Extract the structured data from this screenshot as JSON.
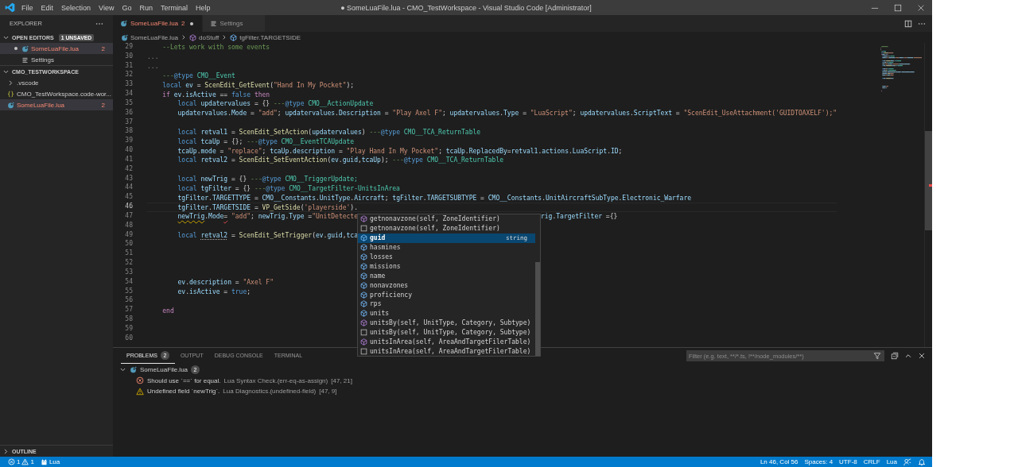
{
  "window": {
    "title": "● SomeLuaFile.lua - CMO_TestWorkspace - Visual Studio Code [Administrator]"
  },
  "menu": [
    "File",
    "Edit",
    "Selection",
    "View",
    "Go",
    "Run",
    "Terminal",
    "Help"
  ],
  "sidebar": {
    "title": "EXPLORER",
    "open_editors": {
      "label": "OPEN EDITORS",
      "badge": "1 UNSAVED",
      "expanded": true,
      "items": [
        {
          "label": "SomeLuaFile.lua",
          "kind": "lua",
          "dirty": true,
          "errors": "2",
          "selected": true
        },
        {
          "label": "Settings",
          "kind": "settings",
          "dirty": false,
          "selected": false
        }
      ]
    },
    "workspace": {
      "label": "CMO_TESTWORKSPACE",
      "expanded": true,
      "items": [
        {
          "label": ".vscode",
          "kind": "folder",
          "expanded": false,
          "selected": false
        },
        {
          "label": "CMO_TestWorkspace.code-wor...",
          "kind": "json",
          "selected": false
        },
        {
          "label": "SomeLuaFile.lua",
          "kind": "lua",
          "errors": "2",
          "selected": true
        }
      ]
    },
    "outline": {
      "label": "OUTLINE",
      "expanded": false
    }
  },
  "tabs": [
    {
      "label": "SomeLuaFile.lua",
      "kind": "lua",
      "errors": "2",
      "dirty": true,
      "selected": true
    },
    {
      "label": "Settings",
      "kind": "settings",
      "dirty": false,
      "selected": false
    }
  ],
  "breadcrumbs": [
    {
      "label": "SomeLuaFile.lua",
      "kind": "lua"
    },
    {
      "label": "doStuff",
      "kind": "method"
    },
    {
      "label": "tgFilter.TARGETSIDE",
      "kind": "field"
    }
  ],
  "editor": {
    "lines": [
      {
        "number": "29",
        "current": false,
        "tokens": [
          {
            "kind": "m",
            "text": "\t--Lets work with some events"
          }
        ]
      },
      {
        "number": "30",
        "current": false,
        "tokens": [
          {
            "kind": "d",
            "text": "..."
          }
        ]
      },
      {
        "number": "31",
        "current": false,
        "tokens": [
          {
            "kind": "d",
            "text": "..."
          }
        ]
      },
      {
        "number": "32",
        "current": false,
        "tokens": [
          {
            "kind": "m",
            "text": "\t---"
          },
          {
            "kind": "a",
            "text": "@type"
          },
          {
            "kind": "t",
            "text": " CMO__Event"
          }
        ]
      },
      {
        "number": "33",
        "current": false,
        "tokens": [
          {
            "kind": "k",
            "text": "\tlocal"
          },
          {
            "kind": "v",
            "text": " ev"
          },
          {
            "kind": "p",
            "text": " = "
          },
          {
            "kind": "f",
            "text": "ScenEdit_GetEvent"
          },
          {
            "kind": "p",
            "text": "("
          },
          {
            "kind": "s",
            "text": "\"Hand In My Pocket\""
          },
          {
            "kind": "p",
            "text": ");"
          }
        ]
      },
      {
        "number": "34",
        "current": false,
        "tokens": [
          {
            "kind": "c",
            "text": "\tif"
          },
          {
            "kind": "v",
            "text": " ev"
          },
          {
            "kind": "p",
            "text": "."
          },
          {
            "kind": "v",
            "text": "isActive"
          },
          {
            "kind": "p",
            "text": " == "
          },
          {
            "kind": "k",
            "text": "false"
          },
          {
            "kind": "c",
            "text": " then"
          }
        ]
      },
      {
        "number": "35",
        "current": false,
        "tokens": [
          {
            "kind": "k",
            "text": "\t\tlocal"
          },
          {
            "kind": "v",
            "text": " updatervalues"
          },
          {
            "kind": "p",
            "text": " = {} "
          },
          {
            "kind": "m",
            "text": "---"
          },
          {
            "kind": "a",
            "text": "@type"
          },
          {
            "kind": "t",
            "text": " CMO__ActionUpdate"
          }
        ]
      },
      {
        "number": "36",
        "current": false,
        "tokens": [
          {
            "kind": "v",
            "text": "\t\tupdatervalues"
          },
          {
            "kind": "p",
            "text": "."
          },
          {
            "kind": "v",
            "text": "Mode"
          },
          {
            "kind": "p",
            "text": " = "
          },
          {
            "kind": "s",
            "text": "\"add\""
          },
          {
            "kind": "p",
            "text": "; "
          },
          {
            "kind": "v",
            "text": "updatervalues"
          },
          {
            "kind": "p",
            "text": "."
          },
          {
            "kind": "v",
            "text": "Description"
          },
          {
            "kind": "p",
            "text": " = "
          },
          {
            "kind": "s",
            "text": "\"Play Axel F\""
          },
          {
            "kind": "p",
            "text": "; "
          },
          {
            "kind": "v",
            "text": "updatervalues"
          },
          {
            "kind": "p",
            "text": "."
          },
          {
            "kind": "v",
            "text": "Type"
          },
          {
            "kind": "p",
            "text": " = "
          },
          {
            "kind": "s",
            "text": "\"LuaScript\""
          },
          {
            "kind": "p",
            "text": "; "
          },
          {
            "kind": "v",
            "text": "updatervalues"
          },
          {
            "kind": "p",
            "text": "."
          },
          {
            "kind": "v",
            "text": "ScriptText"
          },
          {
            "kind": "p",
            "text": " = "
          },
          {
            "kind": "s",
            "text": "\"ScenEdit_UseAttachment('GUIDTOAXELF');\""
          }
        ]
      },
      {
        "number": "37",
        "current": false
      },
      {
        "number": "38",
        "current": false,
        "tokens": [
          {
            "kind": "k",
            "text": "\t\tlocal"
          },
          {
            "kind": "v",
            "text": " retval1"
          },
          {
            "kind": "p",
            "text": " = "
          },
          {
            "kind": "f",
            "text": "ScenEdit_SetAction"
          },
          {
            "kind": "p",
            "text": "("
          },
          {
            "kind": "v",
            "text": "updatervalues"
          },
          {
            "kind": "p",
            "text": ") "
          },
          {
            "kind": "m",
            "text": "---"
          },
          {
            "kind": "a",
            "text": "@type"
          },
          {
            "kind": "t",
            "text": " CMO__TCA_ReturnTable"
          }
        ]
      },
      {
        "number": "39",
        "current": false,
        "tokens": [
          {
            "kind": "k",
            "text": "\t\tlocal"
          },
          {
            "kind": "v",
            "text": " tcaUp"
          },
          {
            "kind": "p",
            "text": " = {}; "
          },
          {
            "kind": "m",
            "text": "---"
          },
          {
            "kind": "a",
            "text": "@type"
          },
          {
            "kind": "t",
            "text": " CMO__EventTCAUpdate"
          }
        ]
      },
      {
        "number": "40",
        "current": false,
        "tokens": [
          {
            "kind": "v",
            "text": "\t\ttcaUp"
          },
          {
            "kind": "p",
            "text": "."
          },
          {
            "kind": "v",
            "text": "mode"
          },
          {
            "kind": "p",
            "text": " = "
          },
          {
            "kind": "s",
            "text": "\"replace\""
          },
          {
            "kind": "p",
            "text": "; "
          },
          {
            "kind": "v",
            "text": "tcaUp"
          },
          {
            "kind": "p",
            "text": "."
          },
          {
            "kind": "v",
            "text": "description"
          },
          {
            "kind": "p",
            "text": " = "
          },
          {
            "kind": "s",
            "text": "\"Play Hand In My Pocket\""
          },
          {
            "kind": "p",
            "text": "; "
          },
          {
            "kind": "v",
            "text": "tcaUp"
          },
          {
            "kind": "p",
            "text": "."
          },
          {
            "kind": "v",
            "text": "ReplacedBy"
          },
          {
            "kind": "p",
            "text": "="
          },
          {
            "kind": "v",
            "text": "retval1"
          },
          {
            "kind": "p",
            "text": "."
          },
          {
            "kind": "v",
            "text": "actions"
          },
          {
            "kind": "p",
            "text": "."
          },
          {
            "kind": "v",
            "text": "LuaScript"
          },
          {
            "kind": "p",
            "text": "."
          },
          {
            "kind": "v",
            "text": "ID"
          },
          {
            "kind": "p",
            "text": ";"
          }
        ]
      },
      {
        "number": "41",
        "current": false,
        "tokens": [
          {
            "kind": "k",
            "text": "\t\tlocal"
          },
          {
            "kind": "v",
            "text": " retval2"
          },
          {
            "kind": "p",
            "text": " = "
          },
          {
            "kind": "f",
            "text": "ScenEdit_SetEventAction"
          },
          {
            "kind": "p",
            "text": "("
          },
          {
            "kind": "v",
            "text": "ev"
          },
          {
            "kind": "p",
            "text": "."
          },
          {
            "kind": "v",
            "text": "guid"
          },
          {
            "kind": "p",
            "text": ","
          },
          {
            "kind": "v",
            "text": "tcaUp"
          },
          {
            "kind": "p",
            "text": "); "
          },
          {
            "kind": "m",
            "text": "---"
          },
          {
            "kind": "a",
            "text": "@type"
          },
          {
            "kind": "t",
            "text": " CMO__TCA_ReturnTable"
          }
        ]
      },
      {
        "number": "42",
        "current": false
      },
      {
        "number": "43",
        "current": false,
        "tokens": [
          {
            "kind": "k",
            "text": "\t\tlocal"
          },
          {
            "kind": "v",
            "text": " newTrig"
          },
          {
            "kind": "p",
            "text": " = {} "
          },
          {
            "kind": "m",
            "text": "---"
          },
          {
            "kind": "a",
            "text": "@type"
          },
          {
            "kind": "t",
            "text": " CMO__TriggerUpdate;"
          }
        ]
      },
      {
        "number": "44",
        "current": false,
        "tokens": [
          {
            "kind": "k",
            "text": "\t\tlocal"
          },
          {
            "kind": "v",
            "text": " tgFilter"
          },
          {
            "kind": "p",
            "text": " = {} "
          },
          {
            "kind": "m",
            "text": "---"
          },
          {
            "kind": "a",
            "text": "@type"
          },
          {
            "kind": "t",
            "text": " CMO__TargetFilter-UnitsInArea"
          }
        ]
      },
      {
        "number": "45",
        "current": false,
        "tokens": [
          {
            "kind": "v",
            "text": "\t\ttgFilter"
          },
          {
            "kind": "p",
            "text": "."
          },
          {
            "kind": "v",
            "text": "TARGETTYPE"
          },
          {
            "kind": "p",
            "text": " = "
          },
          {
            "kind": "v",
            "text": "CMO__Constants"
          },
          {
            "kind": "p",
            "text": "."
          },
          {
            "kind": "v",
            "text": "UnitType"
          },
          {
            "kind": "p",
            "text": "."
          },
          {
            "kind": "v",
            "text": "Aircraft"
          },
          {
            "kind": "p",
            "text": "; "
          },
          {
            "kind": "v",
            "text": "tgFilter"
          },
          {
            "kind": "p",
            "text": "."
          },
          {
            "kind": "v",
            "text": "TARGETSUBTYPE"
          },
          {
            "kind": "p",
            "text": " = "
          },
          {
            "kind": "v",
            "text": "CMO__Constants"
          },
          {
            "kind": "p",
            "text": "."
          },
          {
            "kind": "v",
            "text": "UnitAircraftSubType"
          },
          {
            "kind": "p",
            "text": "."
          },
          {
            "kind": "v",
            "text": "Electronic_Warfare"
          }
        ]
      },
      {
        "number": "46",
        "current": true,
        "tokens": [
          {
            "kind": "v",
            "text": "\t\ttgFilter"
          },
          {
            "kind": "p",
            "text": "."
          },
          {
            "kind": "v",
            "text": "TARGETSIDE"
          },
          {
            "kind": "p",
            "text": " = "
          },
          {
            "kind": "f",
            "text": "VP_GetSide"
          },
          {
            "kind": "p",
            "text": "("
          },
          {
            "kind": "s",
            "text": "'playerside'"
          },
          {
            "kind": "p",
            "text": ")."
          }
        ]
      },
      {
        "number": "47",
        "current": false,
        "tokens": [
          {
            "kind": "vwarn",
            "text": "\t\tnewTrig"
          },
          {
            "kind": "p",
            "text": "."
          },
          {
            "kind": "v",
            "text": "Mode"
          },
          {
            "kind": "perror",
            "text": "="
          },
          {
            "kind": "s",
            "text": " \"add\""
          },
          {
            "kind": "p",
            "text": "; "
          },
          {
            "kind": "v",
            "text": "newTrig"
          },
          {
            "kind": "p",
            "text": "."
          },
          {
            "kind": "v",
            "text": "Type"
          },
          {
            "kind": "p",
            "text": " ="
          },
          {
            "kind": "s",
            "text": "\"UnitDetecte"
          }
        ],
        "tail": [
          {
            "kind": "v",
            "text": "rig"
          },
          {
            "kind": "p",
            "text": "."
          },
          {
            "kind": "v",
            "text": "TargetFilter"
          },
          {
            "kind": "p",
            "text": " ={}"
          }
        ]
      },
      {
        "number": "48",
        "current": false
      },
      {
        "number": "49",
        "current": false,
        "tokens": [
          {
            "kind": "k",
            "text": "\t\tlocal "
          },
          {
            "kind": "vhint",
            "text": "retval2"
          },
          {
            "kind": "p",
            "text": " = "
          },
          {
            "kind": "f",
            "text": "ScenEdit_SetTrigger"
          },
          {
            "kind": "p",
            "text": "("
          },
          {
            "kind": "v",
            "text": "ev"
          },
          {
            "kind": "p",
            "text": "."
          },
          {
            "kind": "v",
            "text": "guid"
          },
          {
            "kind": "p",
            "text": ","
          },
          {
            "kind": "v",
            "text": "tca"
          }
        ]
      },
      {
        "number": "50",
        "current": false
      },
      {
        "number": "51",
        "current": false
      },
      {
        "number": "52",
        "current": false
      },
      {
        "number": "53",
        "current": false
      },
      {
        "number": "54",
        "current": false,
        "tokens": [
          {
            "kind": "v",
            "text": "\t\tev"
          },
          {
            "kind": "p",
            "text": "."
          },
          {
            "kind": "v",
            "text": "description"
          },
          {
            "kind": "p",
            "text": " = "
          },
          {
            "kind": "s",
            "text": "\"Axel F\""
          }
        ]
      },
      {
        "number": "55",
        "current": false,
        "tokens": [
          {
            "kind": "v",
            "text": "\t\tev"
          },
          {
            "kind": "p",
            "text": "."
          },
          {
            "kind": "v",
            "text": "isActive"
          },
          {
            "kind": "p",
            "text": " = "
          },
          {
            "kind": "k",
            "text": "true"
          },
          {
            "kind": "p",
            "text": ";"
          }
        ]
      },
      {
        "number": "56",
        "current": false
      },
      {
        "number": "57",
        "current": false,
        "tokens": [
          {
            "kind": "c",
            "text": "\tend"
          }
        ]
      },
      {
        "number": "58",
        "current": false
      },
      {
        "number": "59",
        "current": false
      },
      {
        "number": "60",
        "current": false
      }
    ]
  },
  "suggest": {
    "items": [
      {
        "label": "getnonavzone(self, ZoneIdentifier)",
        "kind": "method",
        "selected": false
      },
      {
        "label": "getnonavzone(self, ZoneIdentifier)",
        "kind": "text",
        "selected": false
      },
      {
        "label": "guid",
        "kind": "field",
        "detail": "string",
        "selected": true
      },
      {
        "label": "hasmines",
        "kind": "field",
        "selected": false
      },
      {
        "label": "losses",
        "kind": "field",
        "selected": false
      },
      {
        "label": "missions",
        "kind": "field",
        "selected": false
      },
      {
        "label": "name",
        "kind": "field",
        "selected": false
      },
      {
        "label": "nonavzones",
        "kind": "field",
        "selected": false
      },
      {
        "label": "proficiency",
        "kind": "field",
        "selected": false
      },
      {
        "label": "rps",
        "kind": "field",
        "selected": false
      },
      {
        "label": "units",
        "kind": "field",
        "selected": false
      },
      {
        "label": "unitsBy(self, UnitType, Category, Subtype)",
        "kind": "method",
        "selected": false
      },
      {
        "label": "unitsBy(self, UnitType, Category, Subtype)",
        "kind": "text",
        "selected": false
      },
      {
        "label": "unitsInArea(self, AreaAndTargetFilerTable)",
        "kind": "method",
        "selected": false
      },
      {
        "label": "unitsInArea(self, AreaAndTargetFilerTable)",
        "kind": "text",
        "selected": false
      }
    ]
  },
  "panel": {
    "tabs": [
      {
        "label": "PROBLEMS",
        "badge": "2",
        "selected": true
      },
      {
        "label": "OUTPUT",
        "selected": false
      },
      {
        "label": "DEBUG CONSOLE",
        "selected": false
      },
      {
        "label": "TERMINAL",
        "selected": false
      }
    ],
    "filter": {
      "placeholder": "Filter (e.g. text, **/*.ts, !**/node_modules/**)"
    },
    "problems": {
      "file": "SomeLuaFile.lua",
      "count": "2",
      "expanded": true,
      "items": [
        {
          "kind": "error",
          "message": "Should use `==` for equal.",
          "source": "Lua Syntax Check.(err-eq-as-assign)",
          "position": "[47, 21]"
        },
        {
          "kind": "warning",
          "message": "Undefined field `newTrig`.",
          "source": "Lua Diagnostics.(undefined-field)",
          "position": "[47, 9]"
        }
      ]
    }
  },
  "status_bar": {
    "errors": "1",
    "warnings": "1",
    "server": "Lua",
    "right": [
      "Ln 46, Col 56",
      "Spaces: 4",
      "UTF-8",
      "CRLF",
      "Lua"
    ]
  }
}
